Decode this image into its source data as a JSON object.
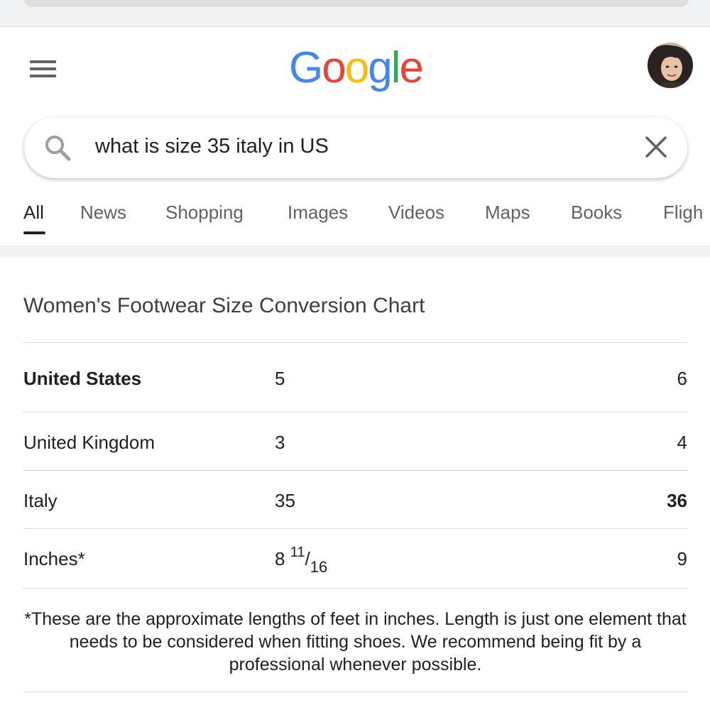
{
  "header": {
    "logo_letters": [
      {
        "ch": "G",
        "color": "#4285F4"
      },
      {
        "ch": "o",
        "color": "#EA4335"
      },
      {
        "ch": "o",
        "color": "#FBBC05"
      },
      {
        "ch": "g",
        "color": "#4285F4"
      },
      {
        "ch": "l",
        "color": "#34A853"
      },
      {
        "ch": "e",
        "color": "#EA4335"
      }
    ],
    "menu_icon": "hamburger-icon",
    "avatar_icon": "user-avatar"
  },
  "search": {
    "query": "what is size 35 italy in US",
    "search_icon": "search-icon",
    "clear_icon": "close-icon"
  },
  "tabs": [
    "All",
    "News",
    "Shopping",
    "Images",
    "Videos",
    "Maps",
    "Books",
    "Fligh"
  ],
  "active_tab": "All",
  "card": {
    "title": "Women's Footwear Size Conversion Chart",
    "rows": [
      {
        "label": "United States",
        "v1": "5",
        "v2": "6"
      },
      {
        "label": "United Kingdom",
        "v1": "3",
        "v2": "4"
      },
      {
        "label": "Italy",
        "v1": "35",
        "v2": "36"
      },
      {
        "label": "Inches*",
        "v1_whole": "8",
        "v1_num": "11",
        "v1_den": "16",
        "v2": "9"
      }
    ],
    "footnote": "*These are the approximate lengths of feet in inches. Length is just one element that needs to be considered when fitting shoes. We recommend being fit by a professional whenever possible."
  },
  "colors": {
    "google_blue": "#4285F4",
    "google_red": "#EA4335",
    "google_yellow": "#FBBC05",
    "google_green": "#34A853",
    "tab_inactive": "#5f6368"
  }
}
